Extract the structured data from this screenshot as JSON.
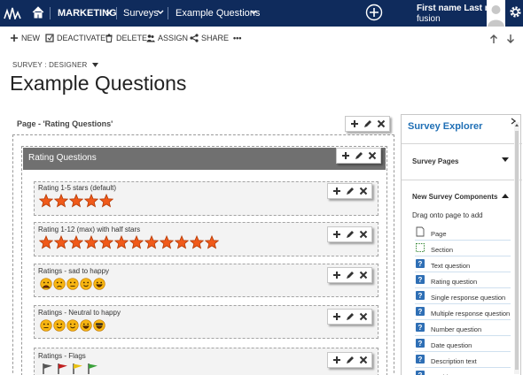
{
  "nav": {
    "app_name": "MARKETING",
    "entity": "Surveys",
    "record": "Example Questions",
    "user_name": "First name Last n...",
    "org": "fusion"
  },
  "command_bar": {
    "new": "NEW",
    "deactivate": "DEACTIVATE",
    "delete": "DELETE",
    "assign": "ASSIGN",
    "share": "SHARE",
    "more": "•••"
  },
  "header": {
    "breadcrumb": "SURVEY : DESIGNER",
    "title": "Example Questions"
  },
  "designer": {
    "page_label": "Page - 'Rating Questions'",
    "section_label": "Rating Questions",
    "questions": [
      {
        "label": "Rating 1-5 stars (default)",
        "icon": "star",
        "count": 5
      },
      {
        "label": "Rating 1-12 (max) with half stars",
        "icon": "star",
        "count": 12
      },
      {
        "label": "Ratings - sad to happy",
        "icon": "sad-to-happy-face",
        "count": 5
      },
      {
        "label": "Ratings - Neutral to happy",
        "icon": "neutral-to-happy-face",
        "count": 5
      },
      {
        "label": "Ratings - Flags",
        "icon": "flag",
        "count": 4
      }
    ]
  },
  "explorer": {
    "title": "Survey Explorer",
    "pages_label": "Survey Pages",
    "components_label": "New Survey Components",
    "drag_hint": "Drag onto page to add",
    "components": [
      "Page",
      "Section",
      "Text question",
      "Rating question",
      "Single response question",
      "Multiple response question",
      "Number question",
      "Date question",
      "Description text",
      "Ranking"
    ]
  },
  "colors": {
    "nav_bg": "#0f2b5c",
    "section_header": "#707070",
    "accent_blue": "#1f6fb5"
  }
}
